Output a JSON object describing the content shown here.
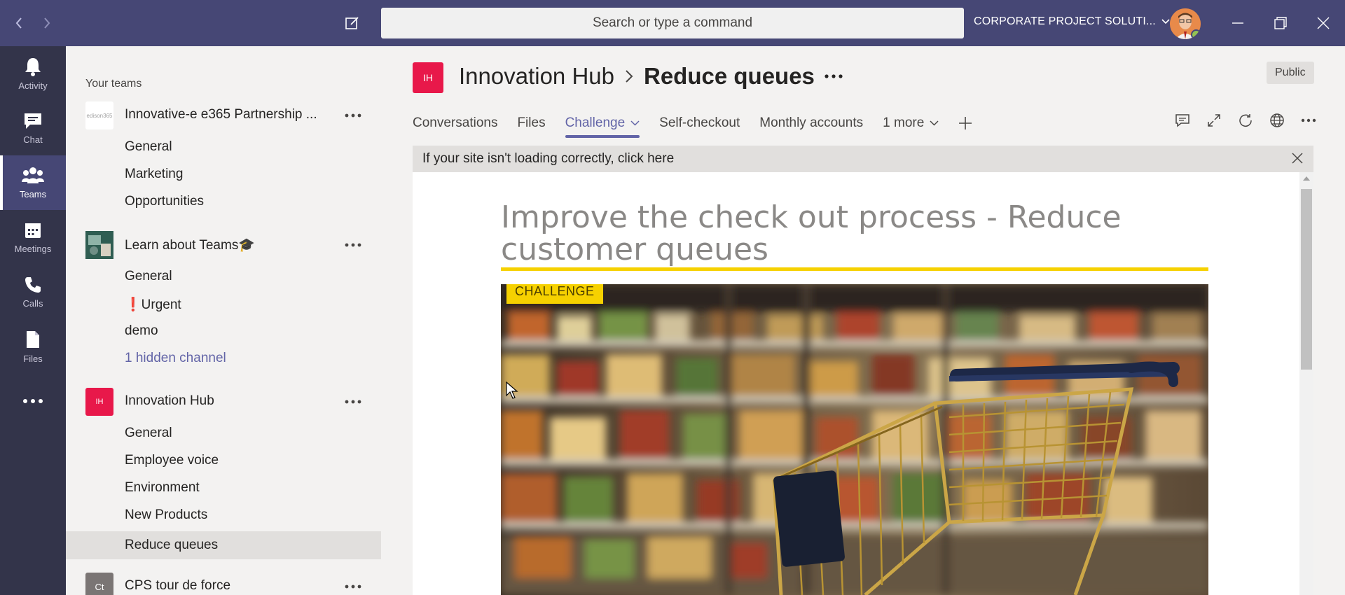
{
  "titlebar": {
    "search_placeholder": "Search or type a command",
    "tenant_name": "CORPORATE PROJECT SOLUTI...",
    "bg_color": "#464775"
  },
  "rail": {
    "items": [
      {
        "label": "Activity",
        "icon": "bell-icon"
      },
      {
        "label": "Chat",
        "icon": "chat-icon"
      },
      {
        "label": "Teams",
        "icon": "teams-icon",
        "active": true
      },
      {
        "label": "Meetings",
        "icon": "calendar-icon"
      },
      {
        "label": "Calls",
        "icon": "phone-icon"
      },
      {
        "label": "Files",
        "icon": "file-icon"
      }
    ]
  },
  "teams_panel": {
    "heading": "Your teams",
    "teams": [
      {
        "name": "Innovative-e e365 Partnership ...",
        "logo_text": "edison365",
        "channels": [
          "General",
          "Marketing",
          "Opportunities"
        ]
      },
      {
        "name": "Learn about Teams🎓",
        "logo_text": "",
        "channels": [
          "General",
          "❗Urgent",
          "demo"
        ],
        "hidden": "1 hidden channel"
      },
      {
        "name": "Innovation Hub",
        "logo_text": "IH",
        "channels": [
          "General",
          "Employee voice",
          "Environment",
          "New Products",
          "Reduce queues"
        ]
      },
      {
        "name": "CPS tour de force",
        "logo_text": "Ct",
        "channels": []
      }
    ]
  },
  "channel_header": {
    "logo_text": "IH",
    "team": "Innovation Hub",
    "channel": "Reduce queues",
    "visibility": "Public",
    "accent": "#e8184a"
  },
  "tabs": [
    "Conversations",
    "Files",
    "Challenge",
    "Self-checkout",
    "Monthly accounts",
    "1 more"
  ],
  "notice": {
    "text": "If your site isn't loading correctly, click here"
  },
  "page": {
    "title": "Improve the check out process - Reduce customer queues",
    "tag": "CHALLENGE",
    "tag_color": "#f6d100"
  }
}
